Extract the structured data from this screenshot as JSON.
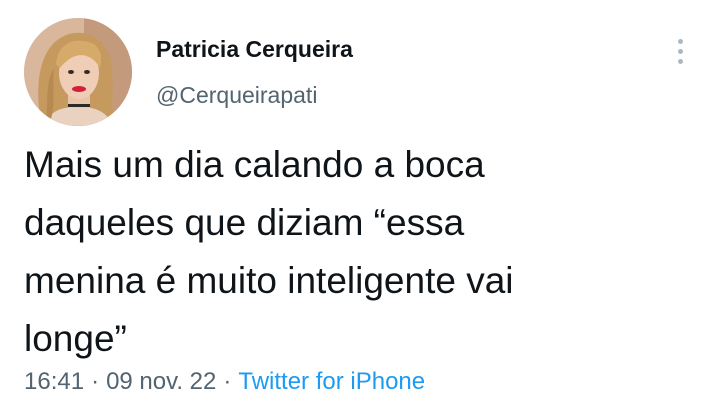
{
  "author": {
    "display_name": "Patricia Cerqueira",
    "handle": "@Cerqueirapati",
    "avatar_icon": "profile-photo"
  },
  "tweet": {
    "text": "Mais um dia calando a boca\ndaqueles que diziam “essa\nmenina é muito inteligente vai\nlonge”",
    "time": "16:41",
    "separator": "·",
    "date": "09 nov. 22",
    "source": "Twitter for iPhone"
  },
  "actions": {
    "more_icon": "more-vertical-icon"
  },
  "colors": {
    "text": "#0f1419",
    "secondary": "#536471",
    "link": "#1d9bf0"
  }
}
